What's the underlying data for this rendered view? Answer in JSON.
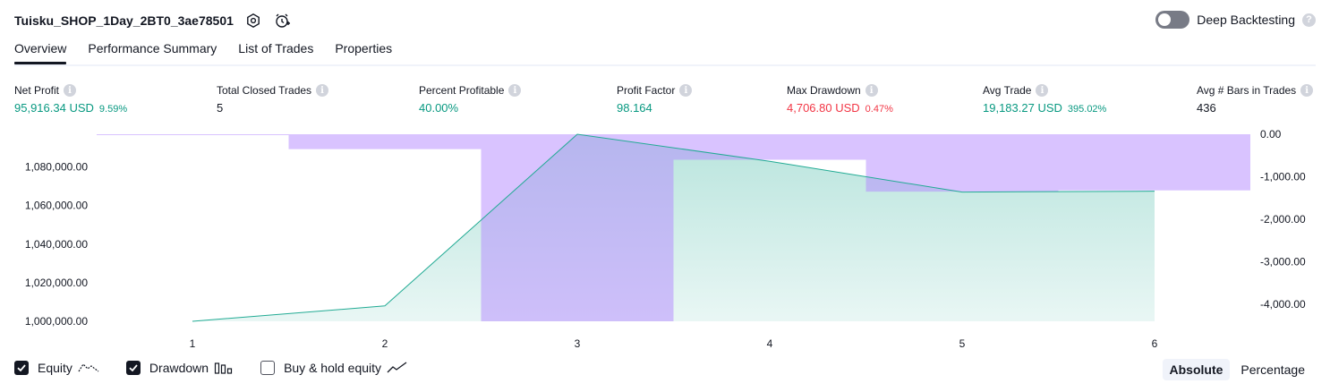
{
  "header": {
    "title": "Tuisku_SHOP_1Day_2BT0_3ae78501",
    "deep_backtesting_label": "Deep Backtesting",
    "deep_backtesting_on": false
  },
  "tabs": [
    {
      "label": "Overview",
      "active": true
    },
    {
      "label": "Performance Summary",
      "active": false
    },
    {
      "label": "List of Trades",
      "active": false
    },
    {
      "label": "Properties",
      "active": false
    }
  ],
  "metrics": {
    "net_profit": {
      "label": "Net Profit",
      "value": "95,916.34 USD",
      "pct": "9.59%"
    },
    "total_closed_trades": {
      "label": "Total Closed Trades",
      "value": "5"
    },
    "percent_profitable": {
      "label": "Percent Profitable",
      "value": "40.00%"
    },
    "profit_factor": {
      "label": "Profit Factor",
      "value": "98.164"
    },
    "max_drawdown": {
      "label": "Max Drawdown",
      "value": "4,706.80 USD",
      "pct": "0.47%"
    },
    "avg_trade": {
      "label": "Avg Trade",
      "value": "19,183.27 USD",
      "pct": "395.02%"
    },
    "avg_bars": {
      "label": "Avg # Bars in Trades",
      "value": "436"
    }
  },
  "colors": {
    "equity_line": "#22ab94",
    "equity_fill": "#22ab94",
    "drawdown_fill": "#b388ff",
    "positive": "#089981",
    "negative": "#f23645"
  },
  "chart_data": {
    "type": "area",
    "x": [
      1,
      2,
      3,
      4,
      5,
      6
    ],
    "x_ticks": [
      "1",
      "2",
      "3",
      "4",
      "5",
      "6"
    ],
    "equity": [
      1000000.0,
      1008000.0,
      1097000.0,
      1083000.0,
      1067000.0,
      1067500.0
    ],
    "drawdown": [
      0.0,
      -350.0,
      -4400.0,
      -600.0,
      -1350.0,
      -1320.0
    ],
    "left_axis": {
      "ticks": [
        "1,080,000.00",
        "1,060,000.00",
        "1,040,000.00",
        "1,020,000.00",
        "1,000,000.00"
      ],
      "values": [
        1080000,
        1060000,
        1040000,
        1020000,
        1000000
      ],
      "range": [
        1000000,
        1097000
      ]
    },
    "right_axis": {
      "ticks": [
        "0.00",
        "-1,000.00",
        "-2,000.00",
        "-3,000.00",
        "-4,000.00"
      ],
      "values": [
        0,
        -1000,
        -2000,
        -3000,
        -4000
      ],
      "range": [
        -4400,
        0
      ]
    }
  },
  "legend": [
    {
      "label": "Equity",
      "checked": true,
      "icon": "equity-line-icon"
    },
    {
      "label": "Drawdown",
      "checked": true,
      "icon": "drawdown-bars-icon"
    },
    {
      "label": "Buy & hold equity",
      "checked": false,
      "icon": "buy-hold-line-icon"
    }
  ],
  "modes": [
    {
      "label": "Absolute",
      "active": true
    },
    {
      "label": "Percentage",
      "active": false
    }
  ]
}
